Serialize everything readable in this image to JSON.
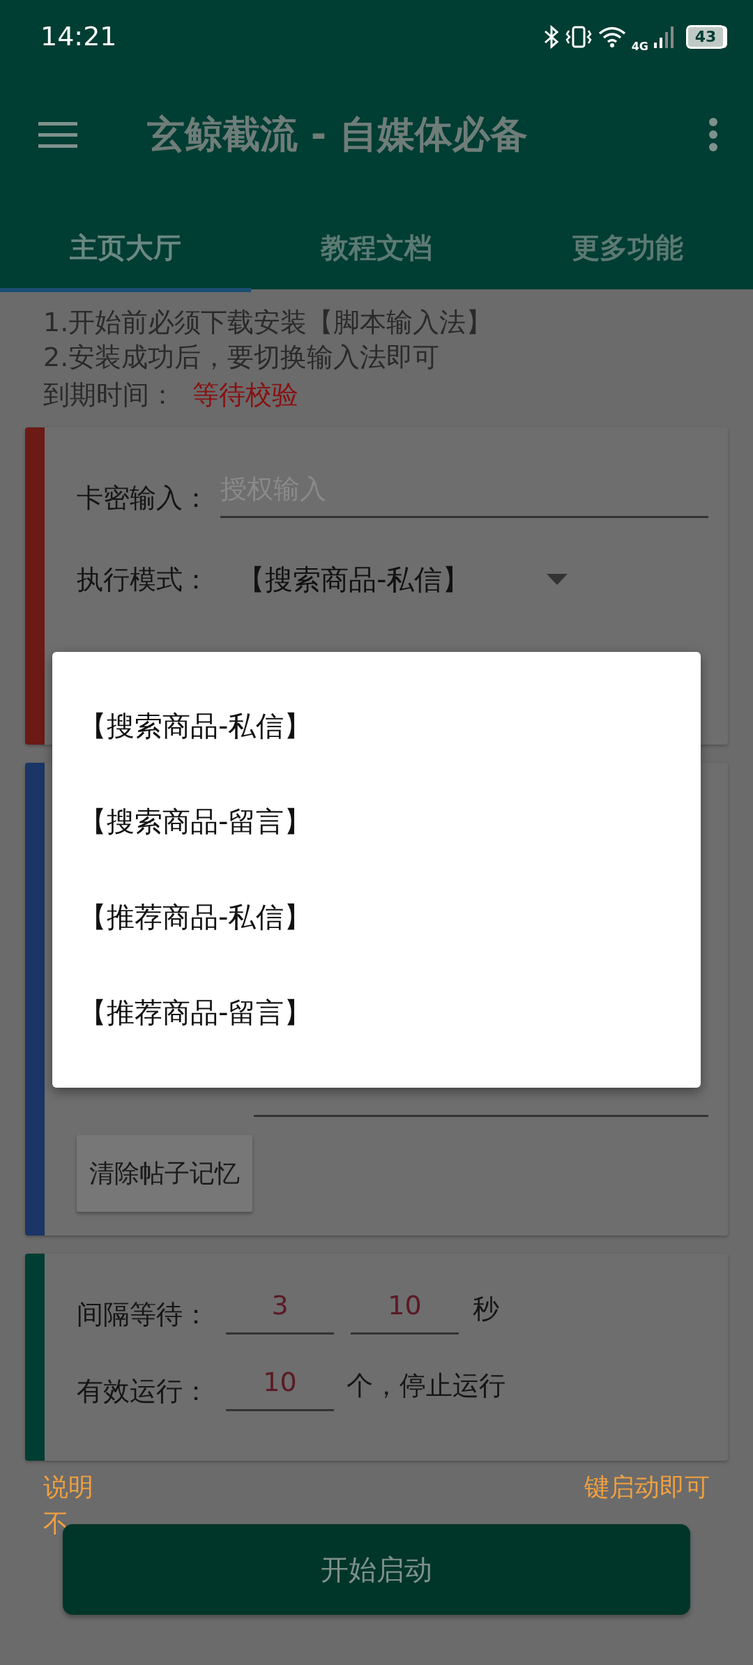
{
  "status_bar": {
    "time": "14:21",
    "network": "4G",
    "battery": "43"
  },
  "app_bar": {
    "title": "玄鲸截流 - 自媒体必备"
  },
  "tabs": [
    {
      "label": "主页大厅",
      "selected": true
    },
    {
      "label": "教程文档",
      "selected": false
    },
    {
      "label": "更多功能",
      "selected": false
    }
  ],
  "intro": {
    "lines": [
      "1.开始前必须下载安装【脚本输入法】",
      "2.安装成功后，要切换输入法即可"
    ],
    "expiry_label": "到期时间：",
    "expiry_value": "等待校验"
  },
  "cards": [
    {
      "kind": "license",
      "color": "#6b1a15",
      "key_label": "卡密输入：",
      "key_placeholder": "授权输入",
      "mode_label": "执行模式：",
      "mode_value": "【搜索商品-私信】"
    },
    {
      "kind": "message",
      "color": "#1a3566",
      "button": "清除帖子记忆"
    },
    {
      "kind": "run",
      "color": "#003d33",
      "interval_label": "间隔等待：",
      "interval_min": "3",
      "interval_max": "10",
      "interval_unit": "秒",
      "count_label": "有效运行：",
      "count": "10",
      "count_suffix": "个，停止运行"
    }
  ],
  "note": {
    "left": "说明",
    "right": "键启动即可",
    "second_line": "不"
  },
  "start_button": "开始启动",
  "dropdown": {
    "options": [
      "【搜索商品-私信】",
      "【搜索商品-留言】",
      "【推荐商品-私信】",
      "【推荐商品-留言】"
    ]
  }
}
